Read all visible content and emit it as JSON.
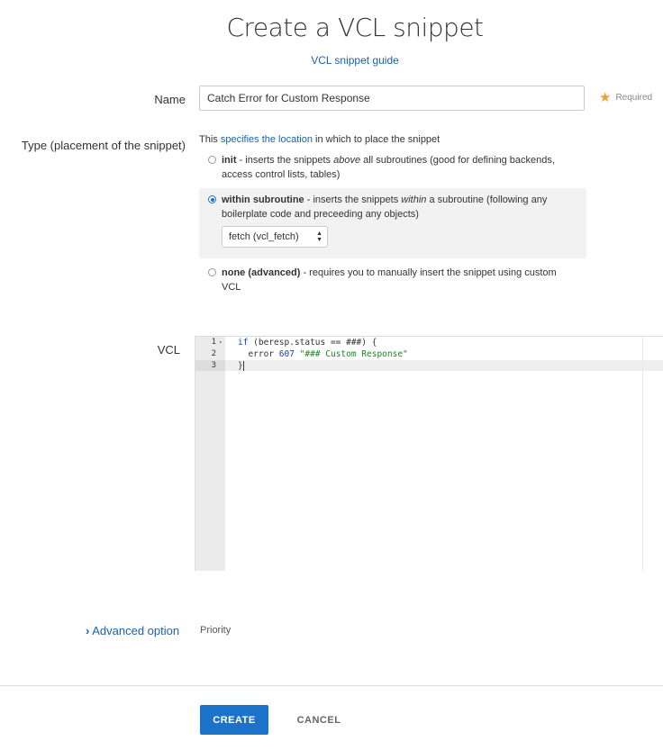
{
  "page": {
    "title": "Create a VCL snippet",
    "guide_link": "VCL snippet guide"
  },
  "name_field": {
    "label": "Name",
    "value": "Catch Error for Custom Response",
    "required_text": "Required"
  },
  "type_field": {
    "label": "Type (placement of the snippet)",
    "desc_prefix": "This ",
    "desc_link": "specifies the location",
    "desc_suffix": " in which to place the snippet",
    "options": [
      {
        "name": "init",
        "desc_a": " - inserts the snippets ",
        "desc_em": "above",
        "desc_b": " all subroutines (good for defining backends, access control lists, tables)",
        "checked": false
      },
      {
        "name": "within subroutine",
        "desc_a": " - inserts the snippets ",
        "desc_em": "within",
        "desc_b": " a subroutine (following any boilerplate code and preceeding any objects)",
        "checked": true
      },
      {
        "name": "none (advanced)",
        "desc_a": " - requires you to manually insert the snippet using custom VCL",
        "desc_em": "",
        "desc_b": "",
        "checked": false
      }
    ],
    "subroutine_select": "fetch (vcl_fetch)"
  },
  "vcl_field": {
    "label": "VCL",
    "lines": [
      {
        "number": "1",
        "kw": "if",
        "text_a": " (beresp.status == ###) {",
        "num": "",
        "str": ""
      },
      {
        "number": "2",
        "kw": "",
        "text_a": "  error ",
        "num": "607",
        "str": " \"### Custom Response\""
      },
      {
        "number": "3",
        "kw": "",
        "text_a": "}",
        "num": "",
        "str": ""
      }
    ]
  },
  "advanced": {
    "label": "Advanced option",
    "chevron": "chevron-right-icon",
    "priority_label": "Priority"
  },
  "actions": {
    "create": "CREATE",
    "cancel": "CANCEL"
  },
  "colors": {
    "accent": "#1a73c8",
    "link": "#1a63a8",
    "required_star": "#f0a030"
  }
}
